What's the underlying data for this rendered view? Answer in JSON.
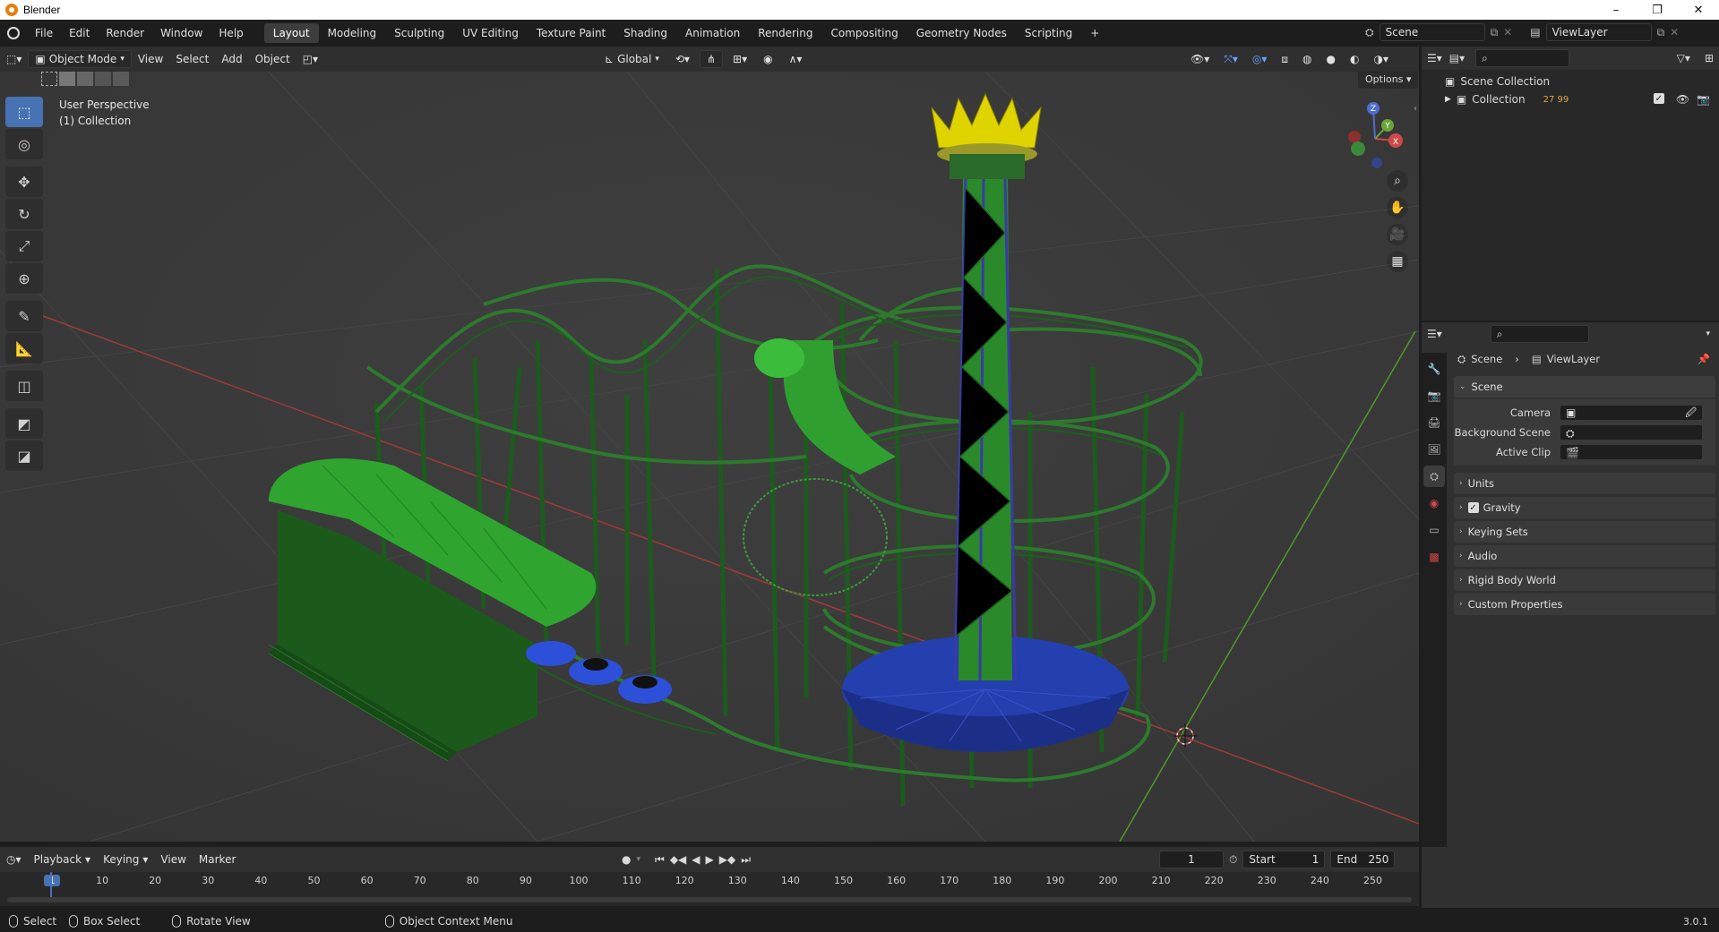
{
  "window": {
    "title": "Blender",
    "controls": [
      "–",
      "❐",
      "✕"
    ]
  },
  "menu": [
    "File",
    "Edit",
    "Render",
    "Window",
    "Help"
  ],
  "workspaces": [
    "Layout",
    "Modeling",
    "Sculpting",
    "UV Editing",
    "Texture Paint",
    "Shading",
    "Animation",
    "Rendering",
    "Compositing",
    "Geometry Nodes",
    "Scripting"
  ],
  "active_workspace": "Layout",
  "scene_field": "Scene",
  "viewlayer_field": "ViewLayer",
  "viewport_header": {
    "mode": "Object Mode",
    "menus": [
      "View",
      "Select",
      "Add",
      "Object"
    ],
    "orientation": "Global"
  },
  "viewport": {
    "info_line1": "User Perspective",
    "info_line2": "(1) Collection",
    "options": "Options",
    "gizmo_axes": [
      "X",
      "Y",
      "Z"
    ]
  },
  "outliner": {
    "root": "Scene Collection",
    "collection": "Collection",
    "collection_counts": "27 99"
  },
  "properties": {
    "breadcrumb": [
      "Scene",
      "ViewLayer"
    ],
    "section": "Scene",
    "rows": [
      {
        "label": "Camera",
        "value": ""
      },
      {
        "label": "Background Scene",
        "value": ""
      },
      {
        "label": "Active Clip",
        "value": ""
      }
    ],
    "panels": [
      "Units",
      "Gravity",
      "Keying Sets",
      "Audio",
      "Rigid Body World",
      "Custom Properties"
    ],
    "gravity_checked": true
  },
  "timeline": {
    "menus": [
      "Playback",
      "Keying",
      "View",
      "Marker"
    ],
    "current_frame": "1",
    "start_label": "Start",
    "start": "1",
    "end_label": "End",
    "end": "250",
    "ticks": [
      "1",
      "10",
      "20",
      "30",
      "40",
      "50",
      "60",
      "70",
      "80",
      "90",
      "100",
      "110",
      "120",
      "130",
      "140",
      "150",
      "160",
      "170",
      "180",
      "190",
      "200",
      "210",
      "220",
      "230",
      "240",
      "250"
    ]
  },
  "statusbar": {
    "select": "Select",
    "box_select": "Box Select",
    "rotate": "Rotate View",
    "context_menu": "Object Context Menu",
    "version": "3.0.1"
  },
  "colors": {
    "accent": "#4772b3",
    "model_green": "#2f8f2f",
    "model_dark_green": "#1f5d1f",
    "model_blue": "#2b4dd6",
    "crown_yellow": "#e0d400",
    "axis_x": "#c03a3a",
    "axis_y": "#5fa82a"
  }
}
